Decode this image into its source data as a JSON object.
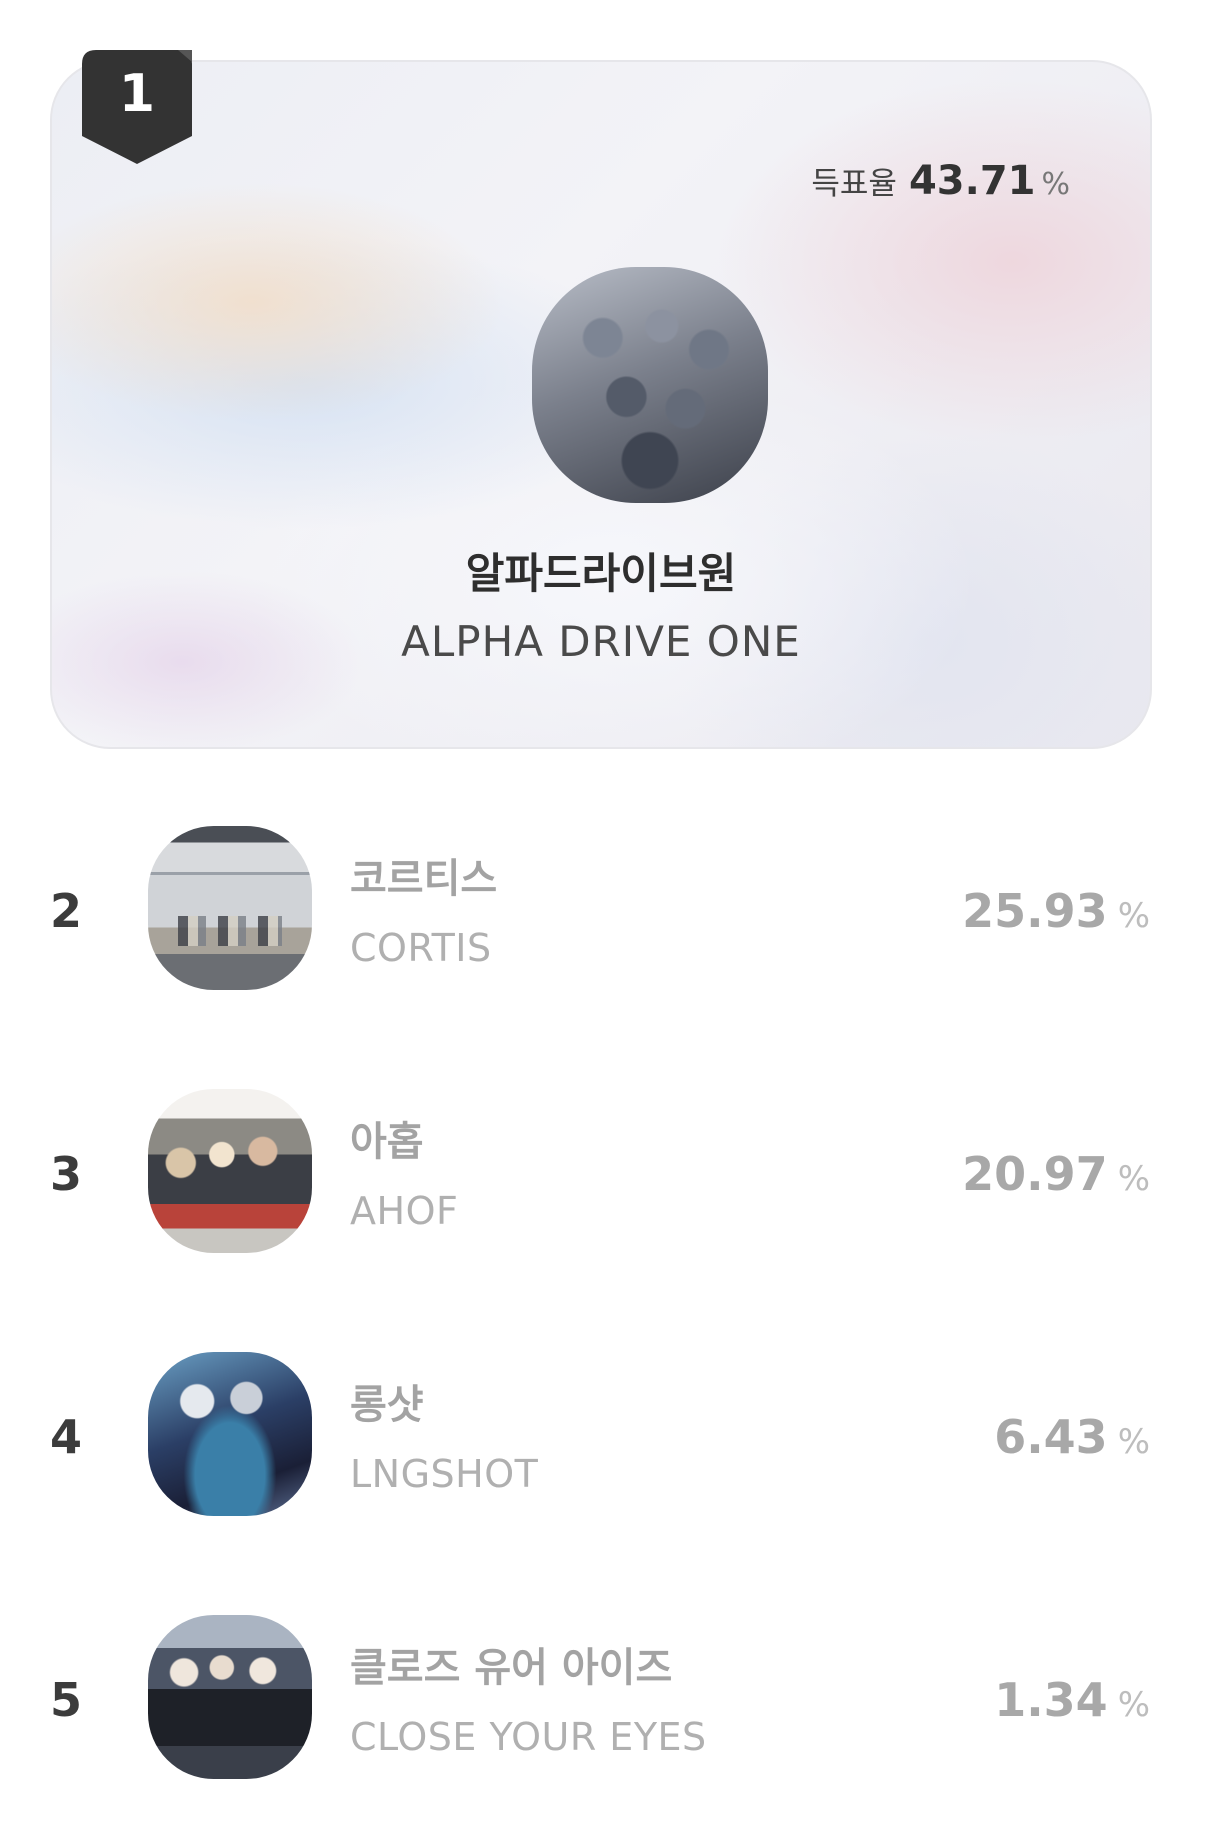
{
  "winner": {
    "rank": "1",
    "vote_rate_label": "득표율",
    "vote_rate_value": "43.71",
    "percent_sign": "%",
    "name_ko": "알파드라이브원",
    "name_en": "ALPHA DRIVE ONE"
  },
  "rankings": [
    {
      "rank": "2",
      "name_ko": "코르티스",
      "name_en": "CORTIS",
      "rate": "25.93",
      "percent_sign": "%"
    },
    {
      "rank": "3",
      "name_ko": "아홉",
      "name_en": "AHOF",
      "rate": "20.97",
      "percent_sign": "%"
    },
    {
      "rank": "4",
      "name_ko": "롱샷",
      "name_en": "LNGSHOT",
      "rate": "6.43",
      "percent_sign": "%"
    },
    {
      "rank": "5",
      "name_ko": "클로즈 유어 아이즈",
      "name_en": "CLOSE YOUR EYES",
      "rate": "1.34",
      "percent_sign": "%"
    }
  ],
  "colors": {
    "rank_tab": "#333333",
    "muted_text": "#a3a3a3",
    "primary_text": "#2e2e2e"
  }
}
